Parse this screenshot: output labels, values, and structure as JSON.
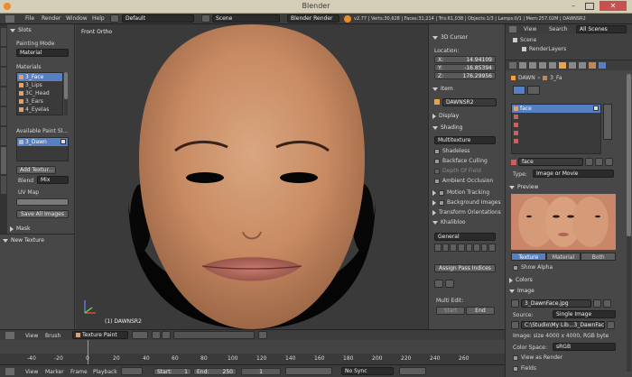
{
  "titlebar": {
    "title": "Blender"
  },
  "top_menu": {
    "file": "File",
    "render": "Render",
    "window": "Window",
    "help": "Help",
    "layout": "Default",
    "scene": "Scene",
    "engine": "Blender Render",
    "stats": "v2.77 | Verts:30,628 | Faces:31,214 | Tris:61,038 | Objects:1/3 | Lamps:0/1 | Mem:257.02M | DAWNSR2"
  },
  "left_panel": {
    "tabs": [
      "Tools",
      "Create",
      "Relations",
      "Animation",
      "Physics",
      "Grease Pencil",
      "Slots",
      "Options"
    ],
    "slots_header": "Slots",
    "painting_mode_label": "Painting Mode",
    "painting_mode": "Material",
    "materials_label": "Materials",
    "materials": [
      "3_Face",
      "3_Lips",
      "3C_Head",
      "3_Ears",
      "4_Eyelas"
    ],
    "available_label": "Available Paint Sl...",
    "available_slot": "3_Dawn",
    "add_texture": "Add Textur...",
    "blend_label": "Blend",
    "blend_value": "Mix",
    "uv_map_label": "UV Map",
    "save_all": "Save All Images",
    "mask_header": "Mask",
    "new_texture": "New Texture"
  },
  "viewport": {
    "view_label": "Front Ortho",
    "object_label": "(1) DAWNSR2"
  },
  "n_panel": {
    "cursor_header": "3D Cursor",
    "location_label": "Location:",
    "x_label": "X:",
    "x_value": "14.94109",
    "y_label": "Y:",
    "y_value": "-16.85394",
    "z_label": "Z:",
    "z_value": "176.29956",
    "item_header": "Item",
    "item_name": "DAWNSR2",
    "display_header": "Display",
    "shading_header": "Shading",
    "shading_mode": "Multitexture",
    "shadeless": "Shadeless",
    "backface": "Backface Culling",
    "dof": "Depth Of Field",
    "ambient": "Ambient Occlusion",
    "motion": "Motion Tracking",
    "bg_images": "Background Images",
    "transform_orient": "Transform Orientations",
    "khalibloo": "Khalibloo",
    "general": "General",
    "assign_pass": "Assign Pass Indices",
    "multi_edit": "Multi Edit:",
    "start": "Start",
    "end": "End"
  },
  "outliner": {
    "view": "View",
    "search": "Search",
    "all_scenes": "All Scenes",
    "scene": "Scene",
    "render_layers": "RenderLayers"
  },
  "properties": {
    "breadcrumb_obj": "DAWN",
    "breadcrumb_mat": "3_Fa",
    "slot_name": "face",
    "tex_name": "face",
    "type_label": "Type:",
    "type_value": "Image or Movie",
    "preview_header": "Preview",
    "tab_texture": "Texture",
    "tab_material": "Material",
    "tab_both": "Both",
    "show_alpha": "Show Alpha",
    "colors_header": "Colors",
    "image_header": "Image",
    "image_name": "3_DawnFace.jpg",
    "source_label": "Source:",
    "source_value": "Single Image",
    "filepath": "C:\\Studio\\My Lib...3_DawnFace.jpg",
    "image_info": "Image: size 4000 x 4000, RGB byte",
    "color_space_label": "Color Space:",
    "color_space_value": "sRGB",
    "view_as_render": "View as Render",
    "fields": "Fields"
  },
  "view_header": {
    "view": "View",
    "brush": "Brush",
    "mode": "Texture Paint"
  },
  "timeline": {
    "ticks": [
      "-40",
      "-20",
      "0",
      "20",
      "40",
      "60",
      "80",
      "100",
      "120",
      "140",
      "160",
      "180",
      "200",
      "220",
      "240",
      "260"
    ],
    "view": "View",
    "marker": "Marker",
    "frame": "Frame",
    "playback": "Playback",
    "start_label": "Start:",
    "start_value": "1",
    "end_label": "End:",
    "end_value": "250",
    "current": "1",
    "sync": "No Sync"
  },
  "colors": {
    "accent": "#5680c2",
    "panel": "#464646",
    "dark": "#2b2b2b",
    "viewport": "#3a3a3a"
  }
}
